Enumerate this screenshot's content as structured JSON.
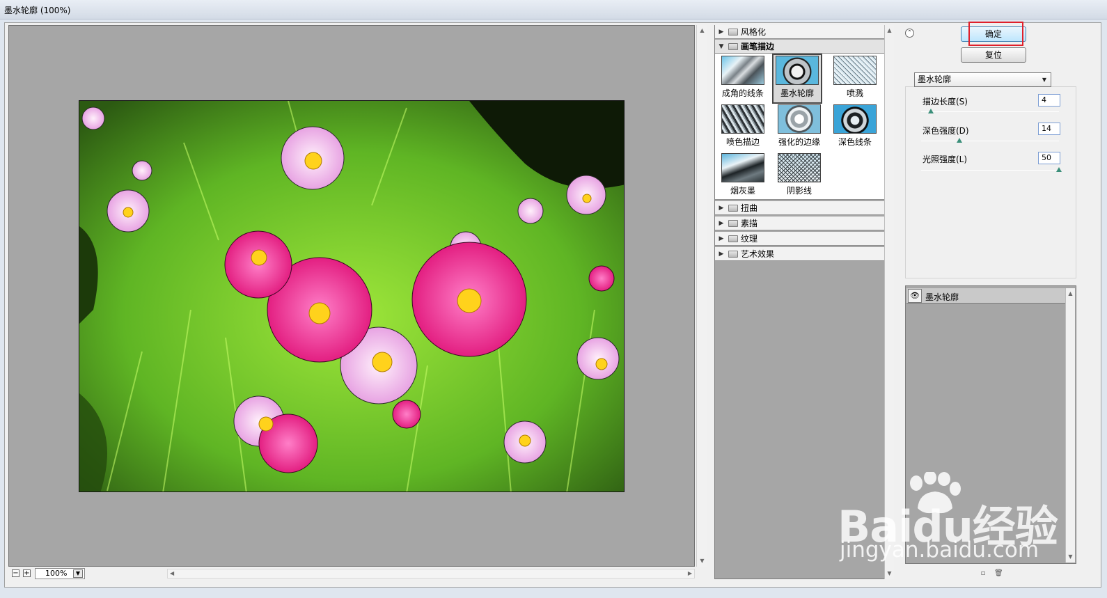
{
  "window": {
    "title": "墨水轮廓 (100%)"
  },
  "preview": {
    "zoom": "100%"
  },
  "gallery": {
    "categories": [
      {
        "label": "风格化",
        "expanded": false
      },
      {
        "label": "画笔描边",
        "expanded": true
      },
      {
        "label": "扭曲",
        "expanded": false
      },
      {
        "label": "素描",
        "expanded": false
      },
      {
        "label": "纹理",
        "expanded": false
      },
      {
        "label": "艺术效果",
        "expanded": false
      }
    ],
    "brush_filters": [
      {
        "label": "成角的线条",
        "icon": "angled-strokes-thumb"
      },
      {
        "label": "墨水轮廓",
        "icon": "ink-outlines-thumb",
        "selected": true
      },
      {
        "label": "喷溅",
        "icon": "spatter-thumb"
      },
      {
        "label": "喷色描边",
        "icon": "sprayed-strokes-thumb"
      },
      {
        "label": "强化的边缘",
        "icon": "accented-edges-thumb"
      },
      {
        "label": "深色线条",
        "icon": "dark-strokes-thumb"
      },
      {
        "label": "烟灰墨",
        "icon": "sumi-e-thumb"
      },
      {
        "label": "阴影线",
        "icon": "crosshatch-thumb"
      }
    ]
  },
  "settings": {
    "ok_label": "确定",
    "reset_label": "复位",
    "filter_select": "墨水轮廓",
    "params": [
      {
        "label": "描边长度(S)",
        "value": "4",
        "fraction": 0.07
      },
      {
        "label": "深色强度(D)",
        "value": "14",
        "fraction": 0.28
      },
      {
        "label": "光照强度(L)",
        "value": "50",
        "fraction": 1.0
      }
    ]
  },
  "layers": {
    "items": [
      {
        "label": "墨水轮廓",
        "visible": true
      }
    ]
  },
  "watermark": {
    "brand": "Baidu经验",
    "url": "jingyan.baidu.com"
  },
  "colors": {
    "ok_highlight": "#e0202a",
    "preview_bg": "#a6a6a6",
    "accent_button": "#bee6fd"
  }
}
